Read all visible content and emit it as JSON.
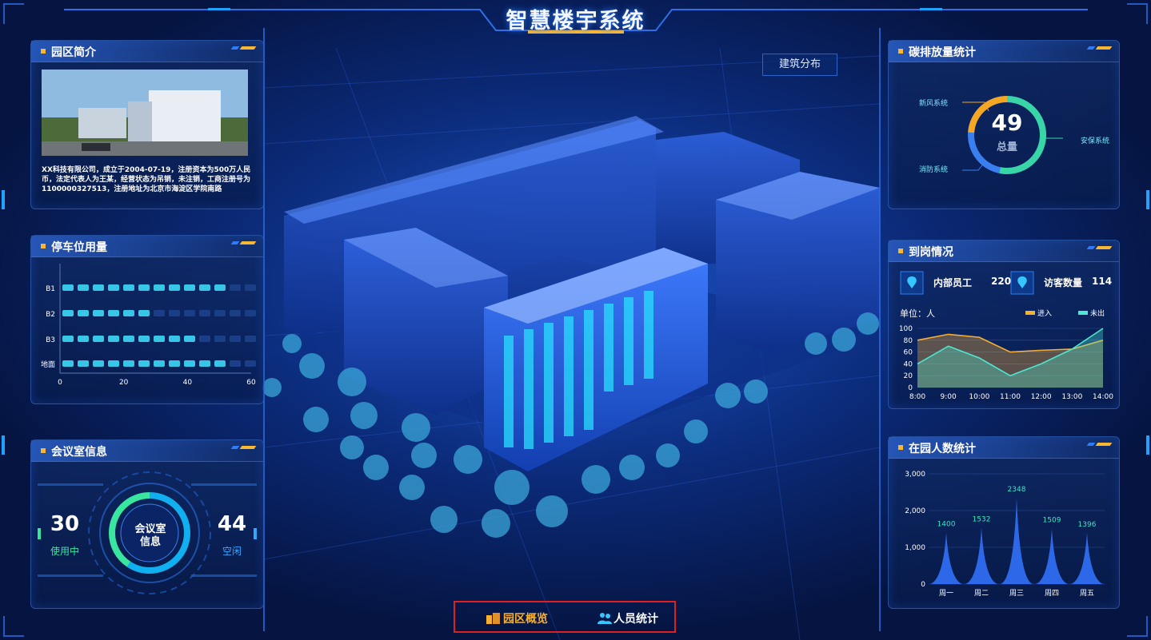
{
  "app_title": "智慧楼宇系统",
  "building_button": "建筑分布",
  "park_intro": {
    "title": "园区简介",
    "text": "XX科技有限公司，成立于2004-07-19，注册资本为500万人民币，法定代表人为王某，经营状态为吊销，未注销，工商注册号为1100000327513，注册地址为北京市海淀区学院南路"
  },
  "parking": {
    "title": "停车位用量",
    "levels": [
      "B1",
      "B2",
      "B3",
      "地面"
    ],
    "used": [
      11,
      6,
      9,
      11
    ],
    "x_ticks": [
      "0",
      "20",
      "40",
      "60"
    ]
  },
  "meeting": {
    "title": "会议室信息",
    "center_line1": "会议室",
    "center_line2": "信息",
    "in_use_value": "30",
    "in_use_label": "使用中",
    "idle_value": "44",
    "idle_label": "空闲"
  },
  "carbon": {
    "title": "碳排放量统计",
    "total": "49",
    "total_label": "总量",
    "labels": [
      "新风系统",
      "安保系统",
      "消防系统"
    ],
    "colors": [
      "#f5a623",
      "#38d6a6",
      "#3a7ff0"
    ]
  },
  "attendance": {
    "title": "到岗情况",
    "staff_label": "内部员工",
    "staff_value": "220",
    "visitor_label": "访客数量",
    "visitor_value": "114",
    "unit": "单位：人",
    "legend_in": "进入",
    "legend_out": "未出"
  },
  "people": {
    "title": "在园人数统计"
  },
  "nav": {
    "overview": "园区概览",
    "people": "人员统计"
  },
  "chart_data": [
    {
      "type": "area",
      "x": [
        "8:00",
        "9:00",
        "10:00",
        "11:00",
        "12:00",
        "13:00",
        "14:00"
      ],
      "series": [
        {
          "name": "进入",
          "values": [
            80,
            90,
            85,
            60,
            63,
            65,
            80
          ]
        },
        {
          "name": "未出",
          "values": [
            40,
            70,
            50,
            20,
            40,
            65,
            100
          ]
        }
      ],
      "ylim": [
        0,
        100
      ],
      "y_ticks": [
        "0",
        "20",
        "40",
        "60",
        "80",
        "100"
      ]
    },
    {
      "type": "area",
      "categories": [
        "周一",
        "周二",
        "周三",
        "周四",
        "周五"
      ],
      "values": [
        1400,
        1532,
        2348,
        1509,
        1396
      ],
      "ylim": [
        0,
        3000
      ],
      "y_ticks": [
        "0",
        "1,000",
        "2,000",
        "3,000"
      ]
    }
  ]
}
